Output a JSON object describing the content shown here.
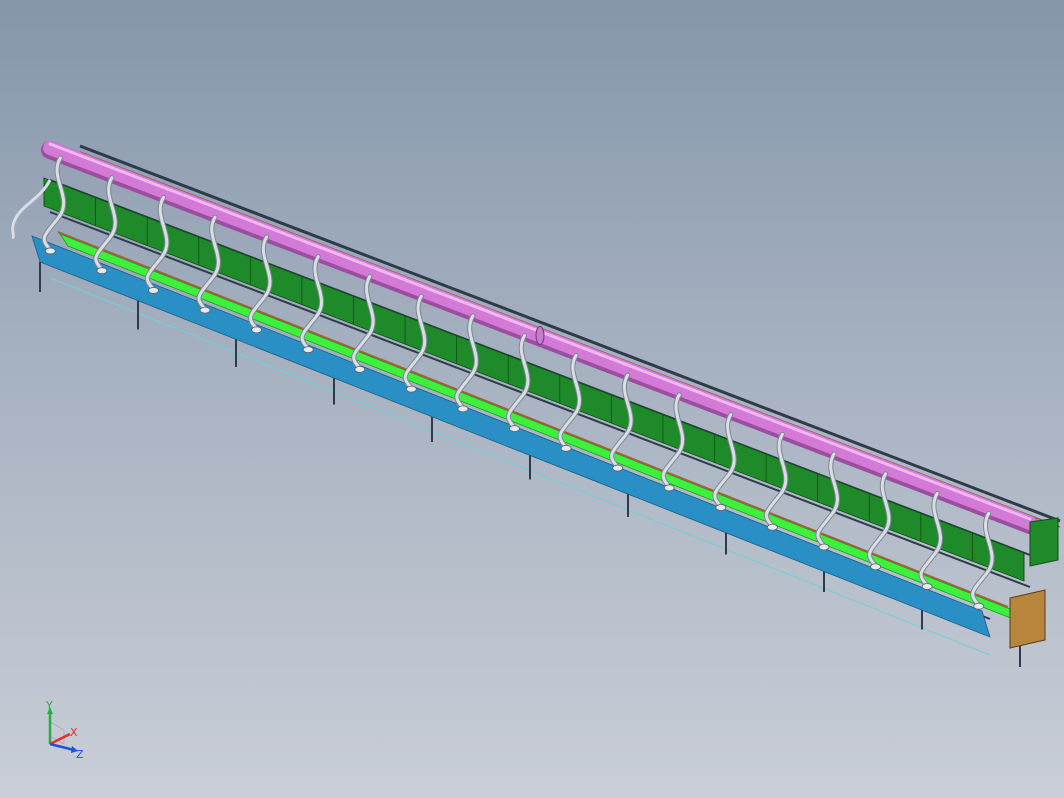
{
  "viewport": {
    "background_top": "#8596ab",
    "background_bottom": "#c9ced7"
  },
  "model": {
    "type": "assembly-line-workbench",
    "stations": 19,
    "colors": {
      "duct": "#d37ad6",
      "panel": "#1f8a2a",
      "conveyor": "#3df03d",
      "shelf": "#2a8fc4",
      "frame": "#2f3a4a",
      "hose": "#d9dde4",
      "cabinet": "#b8853d",
      "wood_rail": "#a0603a"
    }
  },
  "triad": {
    "x_label": "X",
    "y_label": "Y",
    "z_label": "Z",
    "x_color": "#e23030",
    "y_color": "#20b040",
    "z_color": "#2050e0"
  }
}
